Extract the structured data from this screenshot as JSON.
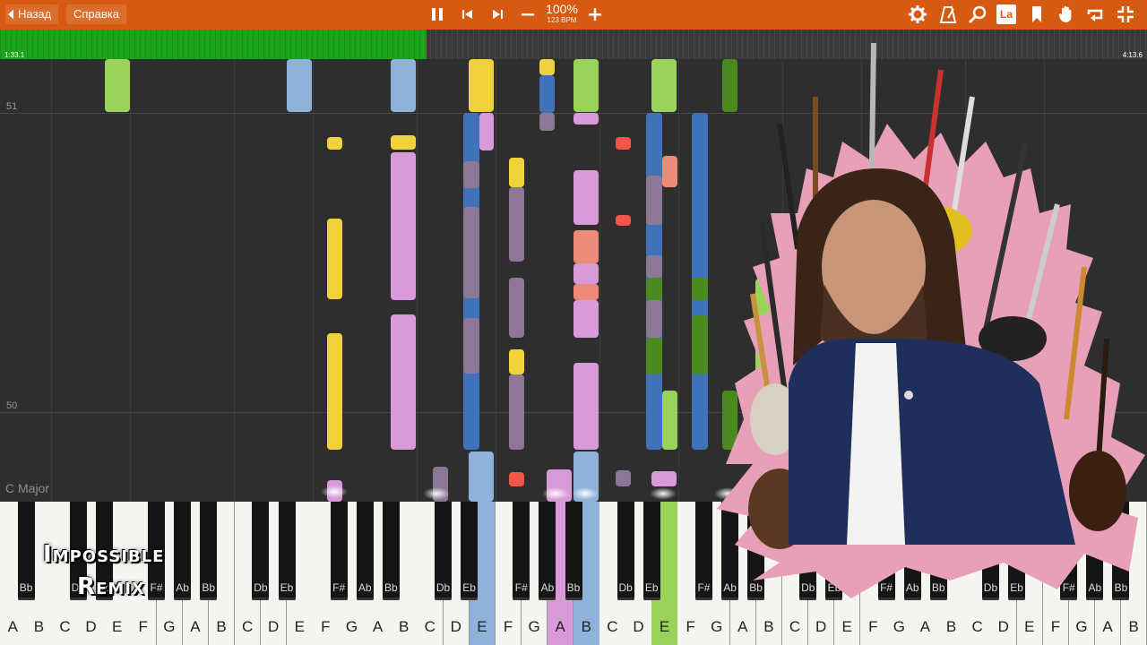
{
  "topbar": {
    "back_label": "Назад",
    "help_label": "Справка",
    "speed_percent": "100%",
    "tempo": "123 BPM",
    "lang_badge": "La",
    "controls": [
      "pause-icon",
      "prev-icon",
      "next-icon",
      "minus-icon",
      "plus-icon"
    ],
    "tools": [
      "gear-icon",
      "metronome-icon",
      "search-icon",
      "label-icon",
      "bookmark-icon",
      "hand-icon",
      "loop-icon",
      "fullscreen-exit-icon"
    ]
  },
  "progress": {
    "elapsed": "1:33.1",
    "total": "4:13.6",
    "fraction": 0.372
  },
  "roll": {
    "measures": [
      "51",
      "50"
    ],
    "key_signature": "C Major"
  },
  "title": {
    "line1": "Impossible",
    "line2": "Remix"
  },
  "keyboard": {
    "white_keys": [
      "A",
      "B",
      "C",
      "D",
      "E",
      "F",
      "G",
      "A",
      "B",
      "C",
      "D",
      "E",
      "F",
      "G",
      "A",
      "B",
      "C",
      "D",
      "E",
      "F",
      "G",
      "A",
      "B",
      "C",
      "D",
      "E",
      "F",
      "G",
      "A",
      "B",
      "C",
      "D",
      "E",
      "F",
      "G",
      "A",
      "B",
      "C",
      "D",
      "E",
      "F",
      "G",
      "A",
      "B"
    ],
    "black_keys": [
      "Bb",
      "Db",
      "Eb",
      "F#",
      "Ab",
      "Bb",
      "Db",
      "Eb",
      "F#",
      "Ab",
      "Bb",
      "Db",
      "Eb",
      "F#",
      "Ab",
      "Bb",
      "Db",
      "Eb",
      "F#",
      "Ab",
      "Bb",
      "Db",
      "Eb",
      "F#",
      "Ab",
      "Bb",
      "Db",
      "Eb",
      "F#",
      "Ab",
      "Bb"
    ]
  },
  "colors": {
    "toolbar": "#d75a10",
    "progress": "#1aa51a",
    "note_green": "#9ad35a",
    "note_blue": "#8fb2da",
    "note_yellow": "#f0d23c",
    "note_pink": "#d89ad8",
    "note_mauve": "#8c7896",
    "note_darkblue": "#3f72b8",
    "note_red": "#f26b5b",
    "note_darkgreen": "#4a8a1e",
    "note_salmon": "#f08a78"
  }
}
